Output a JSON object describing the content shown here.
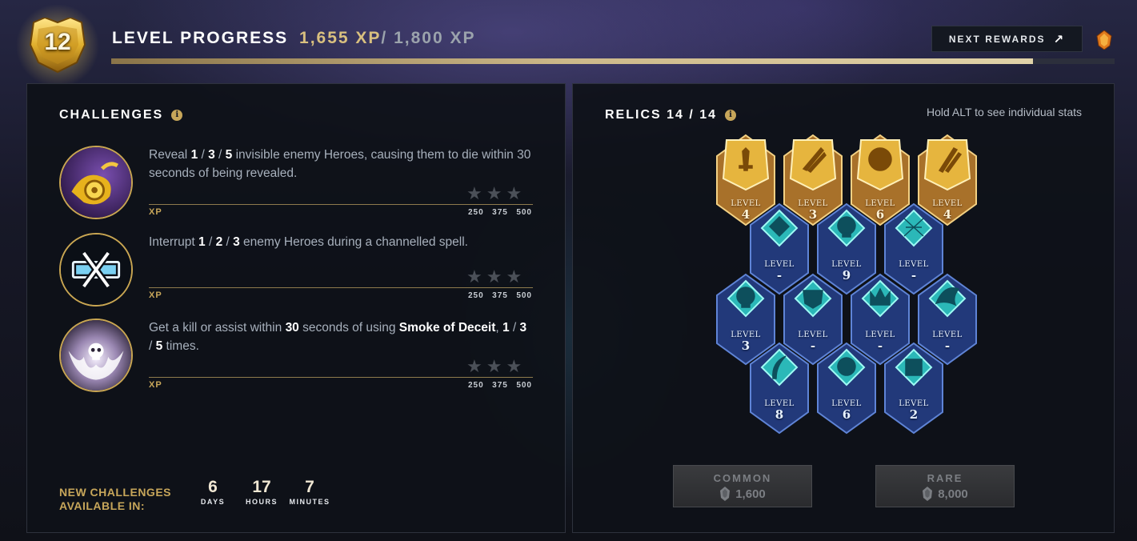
{
  "header": {
    "level": "12",
    "title": "LEVEL PROGRESS",
    "current_xp": "1,655 XP",
    "separator": "/",
    "max_xp": "1,800 XP",
    "progress_fraction": 0.919,
    "next_rewards_label": "NEXT REWARDS",
    "next_rewards_icon": "external-arrow-icon"
  },
  "challenges": {
    "title": "CHALLENGES",
    "items": [
      {
        "icon": "wisp-scroll-icon",
        "parts": [
          {
            "t": "Reveal ",
            "b": false
          },
          {
            "t": "1",
            "b": true
          },
          {
            "t": " / ",
            "b": false
          },
          {
            "t": "3",
            "b": true
          },
          {
            "t": " / ",
            "b": false
          },
          {
            "t": "5",
            "b": true
          },
          {
            "t": " invisible enemy Heroes, causing them to die within 30 seconds of being revealed.",
            "b": false
          }
        ],
        "stars": "★★★",
        "xp_label": "XP",
        "xp_values": [
          "250",
          "375",
          "500"
        ]
      },
      {
        "icon": "interrupt-bar-icon",
        "parts": [
          {
            "t": "Interrupt ",
            "b": false
          },
          {
            "t": "1",
            "b": true
          },
          {
            "t": " / ",
            "b": false
          },
          {
            "t": "2",
            "b": true
          },
          {
            "t": " / ",
            "b": false
          },
          {
            "t": "3",
            "b": true
          },
          {
            "t": " enemy Heroes during a channelled spell.",
            "b": false
          }
        ],
        "stars": "★★★",
        "xp_label": "XP",
        "xp_values": [
          "250",
          "375",
          "500"
        ]
      },
      {
        "icon": "skull-smoke-icon",
        "parts": [
          {
            "t": "Get a kill or assist within ",
            "b": false
          },
          {
            "t": "30",
            "b": true
          },
          {
            "t": " seconds of using ",
            "b": false
          },
          {
            "t": "Smoke of Deceit",
            "b": true
          },
          {
            "t": ", ",
            "b": false
          },
          {
            "t": "1",
            "b": true
          },
          {
            "t": " / ",
            "b": false
          },
          {
            "t": "3",
            "b": true
          },
          {
            "t": " / ",
            "b": false
          },
          {
            "t": "5",
            "b": true
          },
          {
            "t": " times.",
            "b": false
          }
        ],
        "stars": "★★★",
        "xp_label": "XP",
        "xp_values": [
          "250",
          "375",
          "500"
        ]
      }
    ],
    "new_label_line1": "NEW CHALLENGES",
    "new_label_line2": "AVAILABLE IN:",
    "timer": [
      {
        "value": "6",
        "unit": "DAYS"
      },
      {
        "value": "17",
        "unit": "HOURS"
      },
      {
        "value": "7",
        "unit": "MINUTES"
      }
    ]
  },
  "relics": {
    "title": "RELICS 14 / 14",
    "hint": "Hold ALT to see individual stats",
    "level_label": "LEVEL",
    "rows": [
      [
        {
          "tier": "gold",
          "icon": "sword-relic-icon",
          "level": "4"
        },
        {
          "tier": "gold",
          "icon": "claw-relic-icon",
          "level": "3"
        },
        {
          "tier": "gold",
          "icon": "face-relic-icon",
          "level": "6"
        },
        {
          "tier": "gold",
          "icon": "slash-relic-icon",
          "level": "4"
        }
      ],
      [
        {
          "tier": "blue",
          "icon": "gem-relic-icon",
          "level": "-"
        },
        {
          "tier": "blue",
          "icon": "skull-relic-icon",
          "level": "9"
        },
        {
          "tier": "blue",
          "icon": "crossed-relic-icon",
          "level": "-"
        }
      ],
      [
        {
          "tier": "blue",
          "icon": "skull-relic-icon",
          "level": "3"
        },
        {
          "tier": "blue",
          "icon": "mask-relic-icon",
          "level": "-"
        },
        {
          "tier": "blue",
          "icon": "crown-relic-icon",
          "level": "-"
        },
        {
          "tier": "blue",
          "icon": "wing-relic-icon",
          "level": "-"
        }
      ],
      [
        {
          "tier": "blue",
          "icon": "feather-relic-icon",
          "level": "8"
        },
        {
          "tier": "blue",
          "icon": "orb-relic-icon",
          "level": "6"
        },
        {
          "tier": "blue",
          "icon": "dice-relic-icon",
          "level": "2"
        }
      ]
    ],
    "buttons": [
      {
        "name": "COMMON",
        "cost": "1,600",
        "icon": "shard-icon"
      },
      {
        "name": "RARE",
        "cost": "8,000",
        "icon": "shard-icon"
      }
    ]
  },
  "colors": {
    "gold": "#c7a65a",
    "progress_gold": "#cdb98a",
    "relic_blue": "#2c4a8a",
    "relic_cyan": "#4fe6e0",
    "relic_gold": "#e6b53e"
  }
}
